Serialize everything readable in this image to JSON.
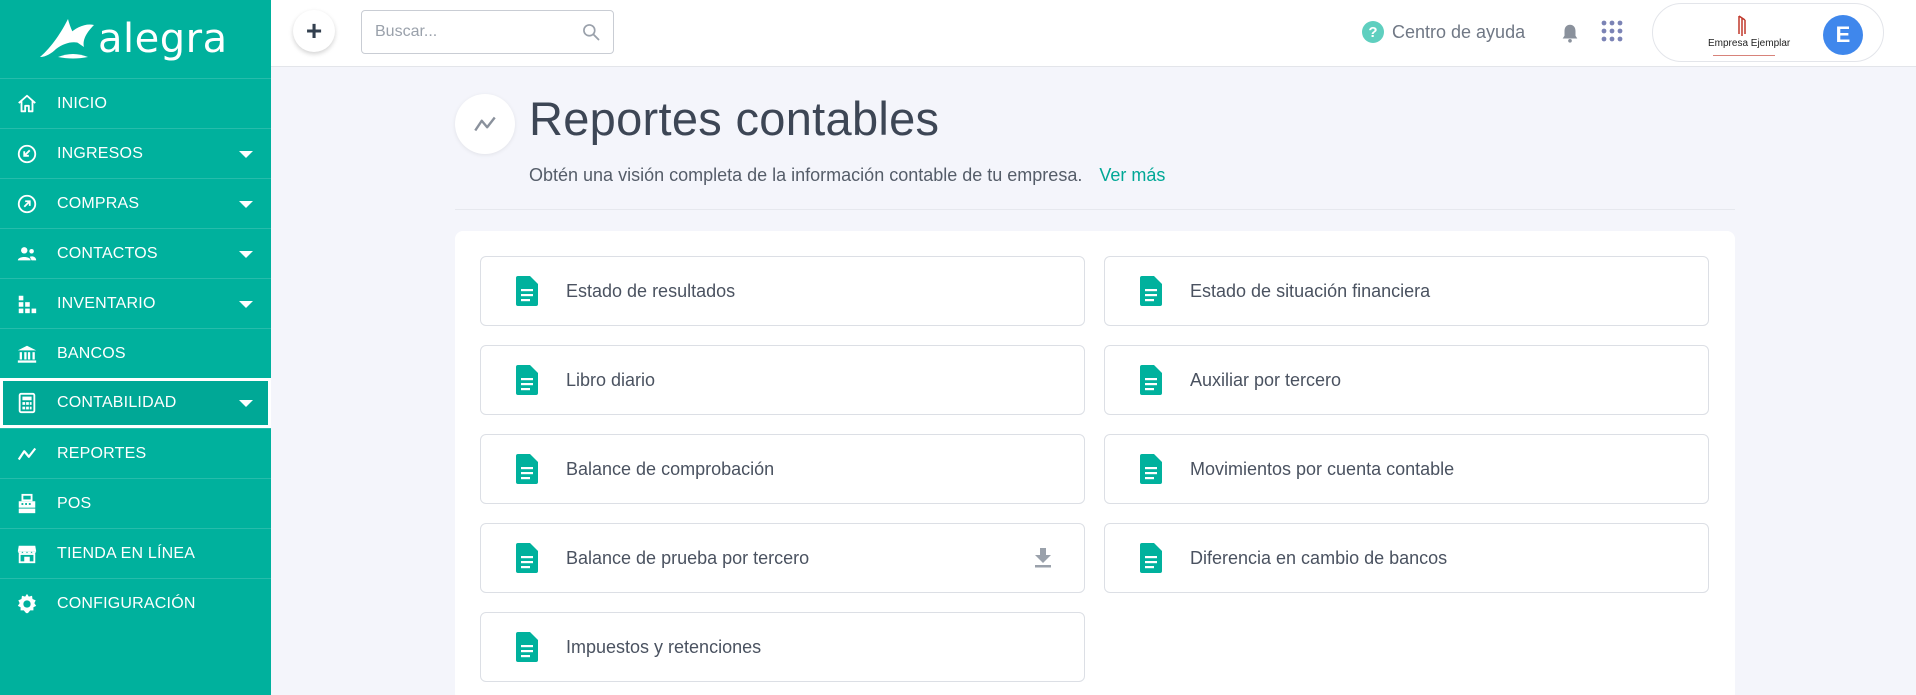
{
  "brand": {
    "name": "alegra"
  },
  "sidebar": {
    "items": [
      {
        "label": "INICIO",
        "icon": "home-icon",
        "has_caret": false
      },
      {
        "label": "INGRESOS",
        "icon": "income-icon",
        "has_caret": true
      },
      {
        "label": "COMPRAS",
        "icon": "purchases-icon",
        "has_caret": true
      },
      {
        "label": "CONTACTOS",
        "icon": "contacts-icon",
        "has_caret": true
      },
      {
        "label": "INVENTARIO",
        "icon": "inventory-icon",
        "has_caret": true
      },
      {
        "label": "BANCOS",
        "icon": "bank-icon",
        "has_caret": false
      },
      {
        "label": "CONTABILIDAD",
        "icon": "accounting-icon",
        "has_caret": true,
        "active": true
      },
      {
        "label": "REPORTES",
        "icon": "reports-icon",
        "has_caret": false
      },
      {
        "label": "POS",
        "icon": "pos-icon",
        "has_caret": false
      },
      {
        "label": "TIENDA EN LÍNEA",
        "icon": "store-icon",
        "has_caret": false
      },
      {
        "label": "CONFIGURACIÓN",
        "icon": "gear-icon",
        "has_caret": false
      }
    ]
  },
  "header": {
    "add_label": "+",
    "search_placeholder": "Buscar...",
    "help_label": "Centro de ayuda",
    "company_name": "Empresa Ejemplar",
    "avatar_initial": "E"
  },
  "page": {
    "title": "Reportes contables",
    "description": "Obtén una visión completa de la información contable de tu empresa.",
    "link": "Ver más"
  },
  "reports": [
    {
      "label": "Estado de resultados"
    },
    {
      "label": "Estado de situación financiera"
    },
    {
      "label": "Libro diario"
    },
    {
      "label": "Auxiliar por tercero"
    },
    {
      "label": "Balance de comprobación"
    },
    {
      "label": "Movimientos por cuenta contable"
    },
    {
      "label": "Balance de prueba por tercero",
      "download": true
    },
    {
      "label": "Diferencia en cambio de bancos"
    },
    {
      "label": "Impuestos y retenciones"
    }
  ],
  "colors": {
    "brand": "#00b19d",
    "accent_link": "#00a896",
    "avatar": "#3f87ec"
  }
}
